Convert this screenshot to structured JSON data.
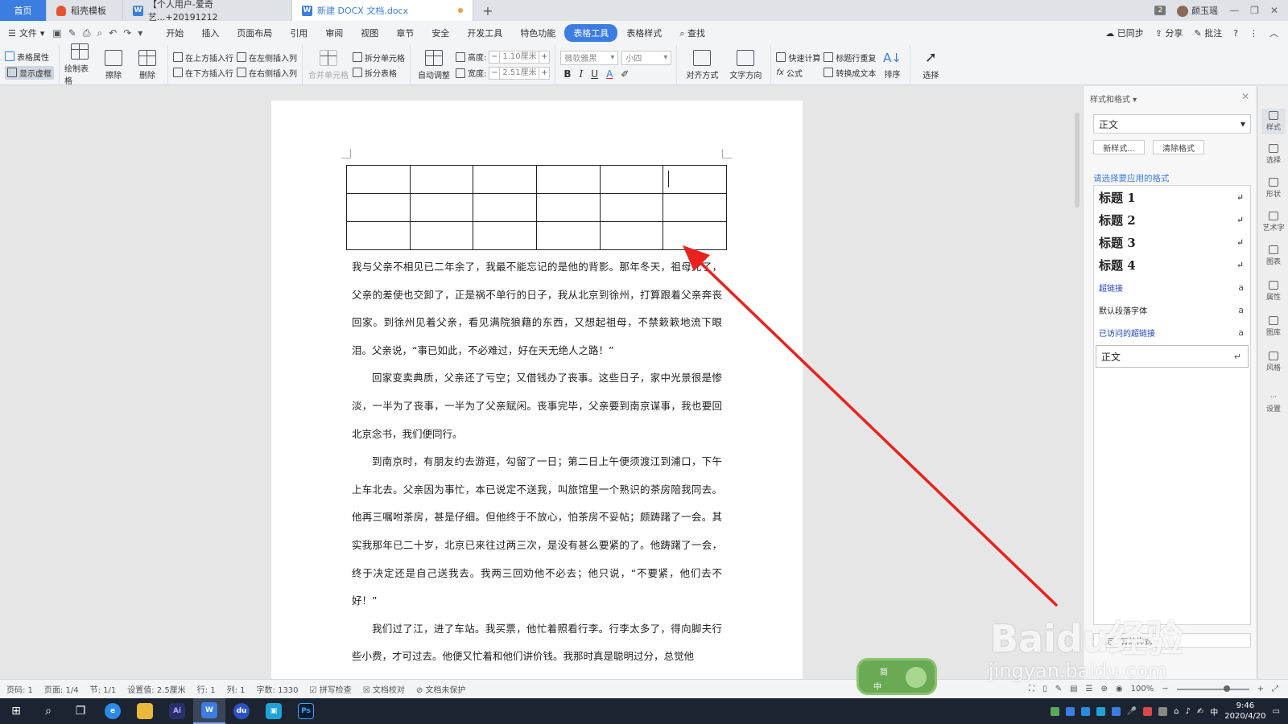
{
  "tabs": {
    "home": "首页",
    "t1": "稻壳模板",
    "t2": "【个人用户-爱奇艺...+20191212",
    "t3": "新建 DOCX 文档.docx",
    "window_count": "2",
    "user": "颜玉瑶"
  },
  "menu": {
    "file": "文件",
    "items": [
      "开始",
      "插入",
      "页面布局",
      "引用",
      "审阅",
      "视图",
      "章节",
      "安全",
      "开发工具",
      "特色功能",
      "表格工具",
      "表格样式"
    ],
    "active": "表格工具",
    "search": "查找",
    "synced": "已同步",
    "share": "分享",
    "comment": "批注"
  },
  "ribbon": {
    "table_props": "表格属性",
    "show_gridlines": "显示虚框",
    "draw_table": "绘制表格",
    "erase": "擦除",
    "delete": "删除",
    "insert_above": "在上方插入行",
    "insert_below": "在下方插入行",
    "insert_left": "在左侧插入列",
    "insert_right": "在右侧插入列",
    "merge_cells": "合并单元格",
    "split_cells": "拆分单元格",
    "split_table": "拆分表格",
    "auto_fit": "自动调整",
    "height_label": "高度:",
    "height_value": "1.10厘米",
    "width_label": "宽度:",
    "width_value": "2.51厘米",
    "font_name": "微软雅黑",
    "font_size": "小四",
    "align": "对齐方式",
    "text_dir": "文字方向",
    "quick_calc": "快速计算",
    "formula": "公式",
    "repeat_header": "标题行重复",
    "to_text": "转换成文本",
    "sort": "排序",
    "select": "选择"
  },
  "document": {
    "table_rows": 3,
    "table_cols": 6,
    "paragraphs": [
      "我与父亲不相见已二年余了，我最不能忘记的是他的背影。那年冬天，祖母死了，父亲的差使也交卸了，正是祸不单行的日子，我从北京到徐州，打算跟着父亲奔丧回家。到徐州见着父亲，看见满院狼藉的东西，又想起祖母，不禁簌簌地流下眼泪。父亲说，“事已如此，不必难过，好在天无绝人之路！”",
      "回家变卖典质，父亲还了亏空；又借钱办了丧事。这些日子，家中光景很是惨淡，一半为了丧事，一半为了父亲赋闲。丧事完毕，父亲要到南京谋事，我也要回北京念书，我们便同行。",
      "到南京时，有朋友约去游逛，勾留了一日；第二日上午便须渡江到浦口，下午上车北去。父亲因为事忙，本已说定不送我，叫旅馆里一个熟识的茶房陪我同去。他再三嘱咐茶房，甚是仔细。但他终于不放心，怕茶房不妥帖；颇踌躇了一会。其实我那年已二十岁，北京已来往过两三次，是没有甚么要紧的了。他踌躇了一会，终于决定还是自己送我去。我两三回劝他不必去；他只说，“不要紧，他们去不好！”",
      "我们过了江，进了车站。我买票，他忙着照看行李。行李太多了，得向脚夫行些小费，才可过去。他便又忙着和他们讲价钱。我那时真是聪明过分，总觉他"
    ]
  },
  "style_panel": {
    "title": "样式和格式",
    "current": "正文",
    "new_style": "新样式...",
    "clear_format": "清除格式",
    "hint": "请选择要应用的格式",
    "items": [
      "标题 1",
      "标题 2",
      "标题 3",
      "标题 4",
      "超链接",
      "默认段落字体",
      "已访问的超链接",
      "正文"
    ],
    "bottom": "显示: 有效样式"
  },
  "sidestrip": [
    "样式",
    "选择",
    "形状",
    "艺术字",
    "图表",
    "属性",
    "图库",
    "风格",
    "设置"
  ],
  "status": {
    "page": "页码: 1",
    "pages": "页面: 1/4",
    "section": "节: 1/1",
    "setting": "设置值: 2.5厘米",
    "row": "行: 1",
    "col": "列: 1",
    "words": "字数: 1330",
    "spell": "拼写检查",
    "proof": "文档校对",
    "protect": "文档未保护",
    "zoom": "100%"
  },
  "ime": {
    "line1": "简",
    "line2": "中"
  },
  "taskbar": {
    "time": "9:46",
    "date": "2020/4/20",
    "lang": "中"
  },
  "watermark": {
    "brand": "Baidu经验",
    "url": "jingyan.baidu.com"
  },
  "colors": {
    "accent": "#3b7de0",
    "arrow": "#e8231d"
  }
}
